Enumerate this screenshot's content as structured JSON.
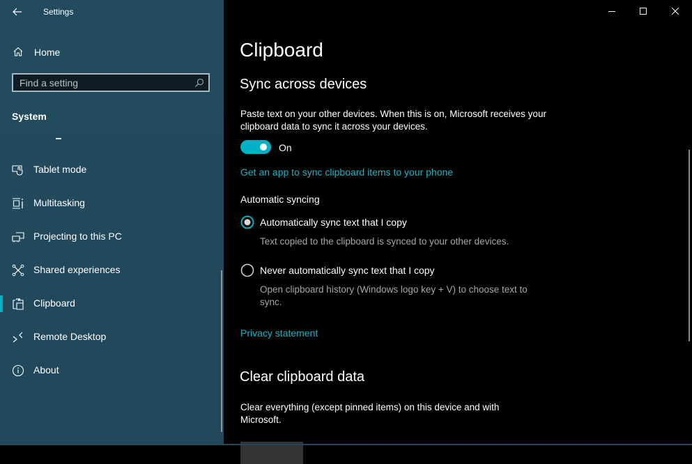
{
  "window": {
    "title": "Settings",
    "controls": {
      "minimize": "minimize-icon",
      "maximize": "maximize-icon",
      "close": "close-icon"
    }
  },
  "sidebar": {
    "back_icon": "back-arrow-icon",
    "home": {
      "label": "Home",
      "icon": "home-icon"
    },
    "search": {
      "placeholder": "Find a setting",
      "value": "",
      "icon": "search-icon"
    },
    "section": "System",
    "items": [
      {
        "label": "Tablet mode",
        "icon": "tablet-mode-icon",
        "active": false
      },
      {
        "label": "Multitasking",
        "icon": "multitasking-icon",
        "active": false
      },
      {
        "label": "Projecting to this PC",
        "icon": "projecting-icon",
        "active": false
      },
      {
        "label": "Shared experiences",
        "icon": "shared-experiences-icon",
        "active": false
      },
      {
        "label": "Clipboard",
        "icon": "clipboard-icon",
        "active": true
      },
      {
        "label": "Remote Desktop",
        "icon": "remote-desktop-icon",
        "active": false
      },
      {
        "label": "About",
        "icon": "info-icon",
        "active": false
      }
    ]
  },
  "main": {
    "title": "Clipboard",
    "sync": {
      "heading": "Sync across devices",
      "description": "Paste text on your other devices. When this is on, Microsoft receives your clipboard data to sync it across your devices.",
      "toggle": {
        "state": true,
        "label": "On"
      },
      "app_link": "Get an app to sync clipboard items to your phone",
      "auto_label": "Automatic syncing",
      "options": [
        {
          "label": "Automatically sync text that I copy",
          "description": "Text copied to the clipboard is synced to your other devices.",
          "selected": true
        },
        {
          "label": "Never automatically sync text that I copy",
          "description": "Open clipboard history (Windows logo key + V) to choose text to sync.",
          "selected": false
        }
      ],
      "privacy_link": "Privacy statement"
    },
    "clear": {
      "heading": "Clear clipboard data",
      "description": "Clear everything (except pinned items) on this device and with Microsoft."
    }
  },
  "colors": {
    "accent": "#00b1c6",
    "link": "#1fb2c4",
    "sidebar_bg": "#224c5e",
    "main_bg": "#000000"
  }
}
